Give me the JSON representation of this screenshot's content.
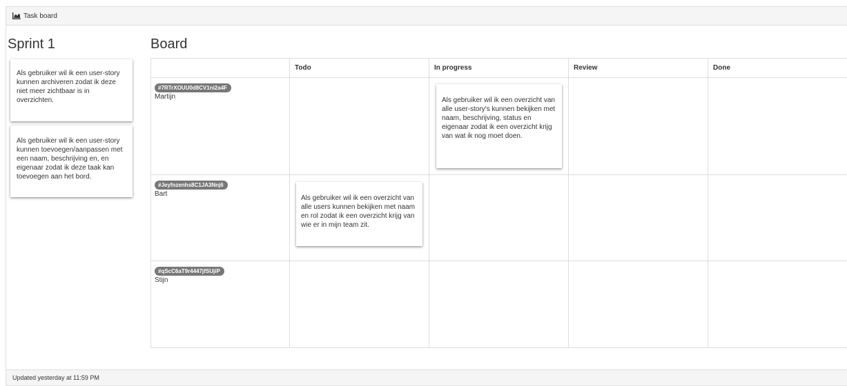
{
  "header": {
    "title": "Task board",
    "icon": "area-chart-icon"
  },
  "sprint": {
    "title": "Sprint 1",
    "backlog": [
      {
        "text": "Als gebruiker wil ik een user-story kunnen archiveren zodat ik deze niet meer zichtbaar is in overzichten."
      },
      {
        "text": "Als gebruiker wil ik een user-story kunnen toevoegen/aanpassen met een naam, beschrijving en, en eigenaar zodat ik deze taak kan toevoegen aan het bord."
      }
    ]
  },
  "board": {
    "title": "Board",
    "columns": [
      "",
      "Todo",
      "In progress",
      "Review",
      "Done"
    ],
    "rows": [
      {
        "id": "#7RTrXOUU0d8CV1ni2a4F",
        "owner": "Martijn",
        "in_progress": "Als gebruiker wil ik een overzicht van alle user-story's kunnen bekijken met naam, beschrijving, status en eigenaar zodat ik een overzicht krijg van wat ik nog moet doen."
      },
      {
        "id": "#Jeyfnzenhs8C1JA3Nnj6",
        "owner": "Bart",
        "todo": "Als gebruiker wil ik een overzicht van alle users kunnen bekijken met naam en rol zodat ik een overzicht krijg van wie er in mijn team zit."
      },
      {
        "id": "#qScC6aT9r4447jfSUjiP",
        "owner": "Stijn"
      }
    ]
  },
  "footer": {
    "updated": "Updated yesterday at 11:59 PM"
  },
  "colors": {
    "badge": "#777777",
    "border": "#dddddd",
    "panel_bg": "#f5f5f5"
  }
}
